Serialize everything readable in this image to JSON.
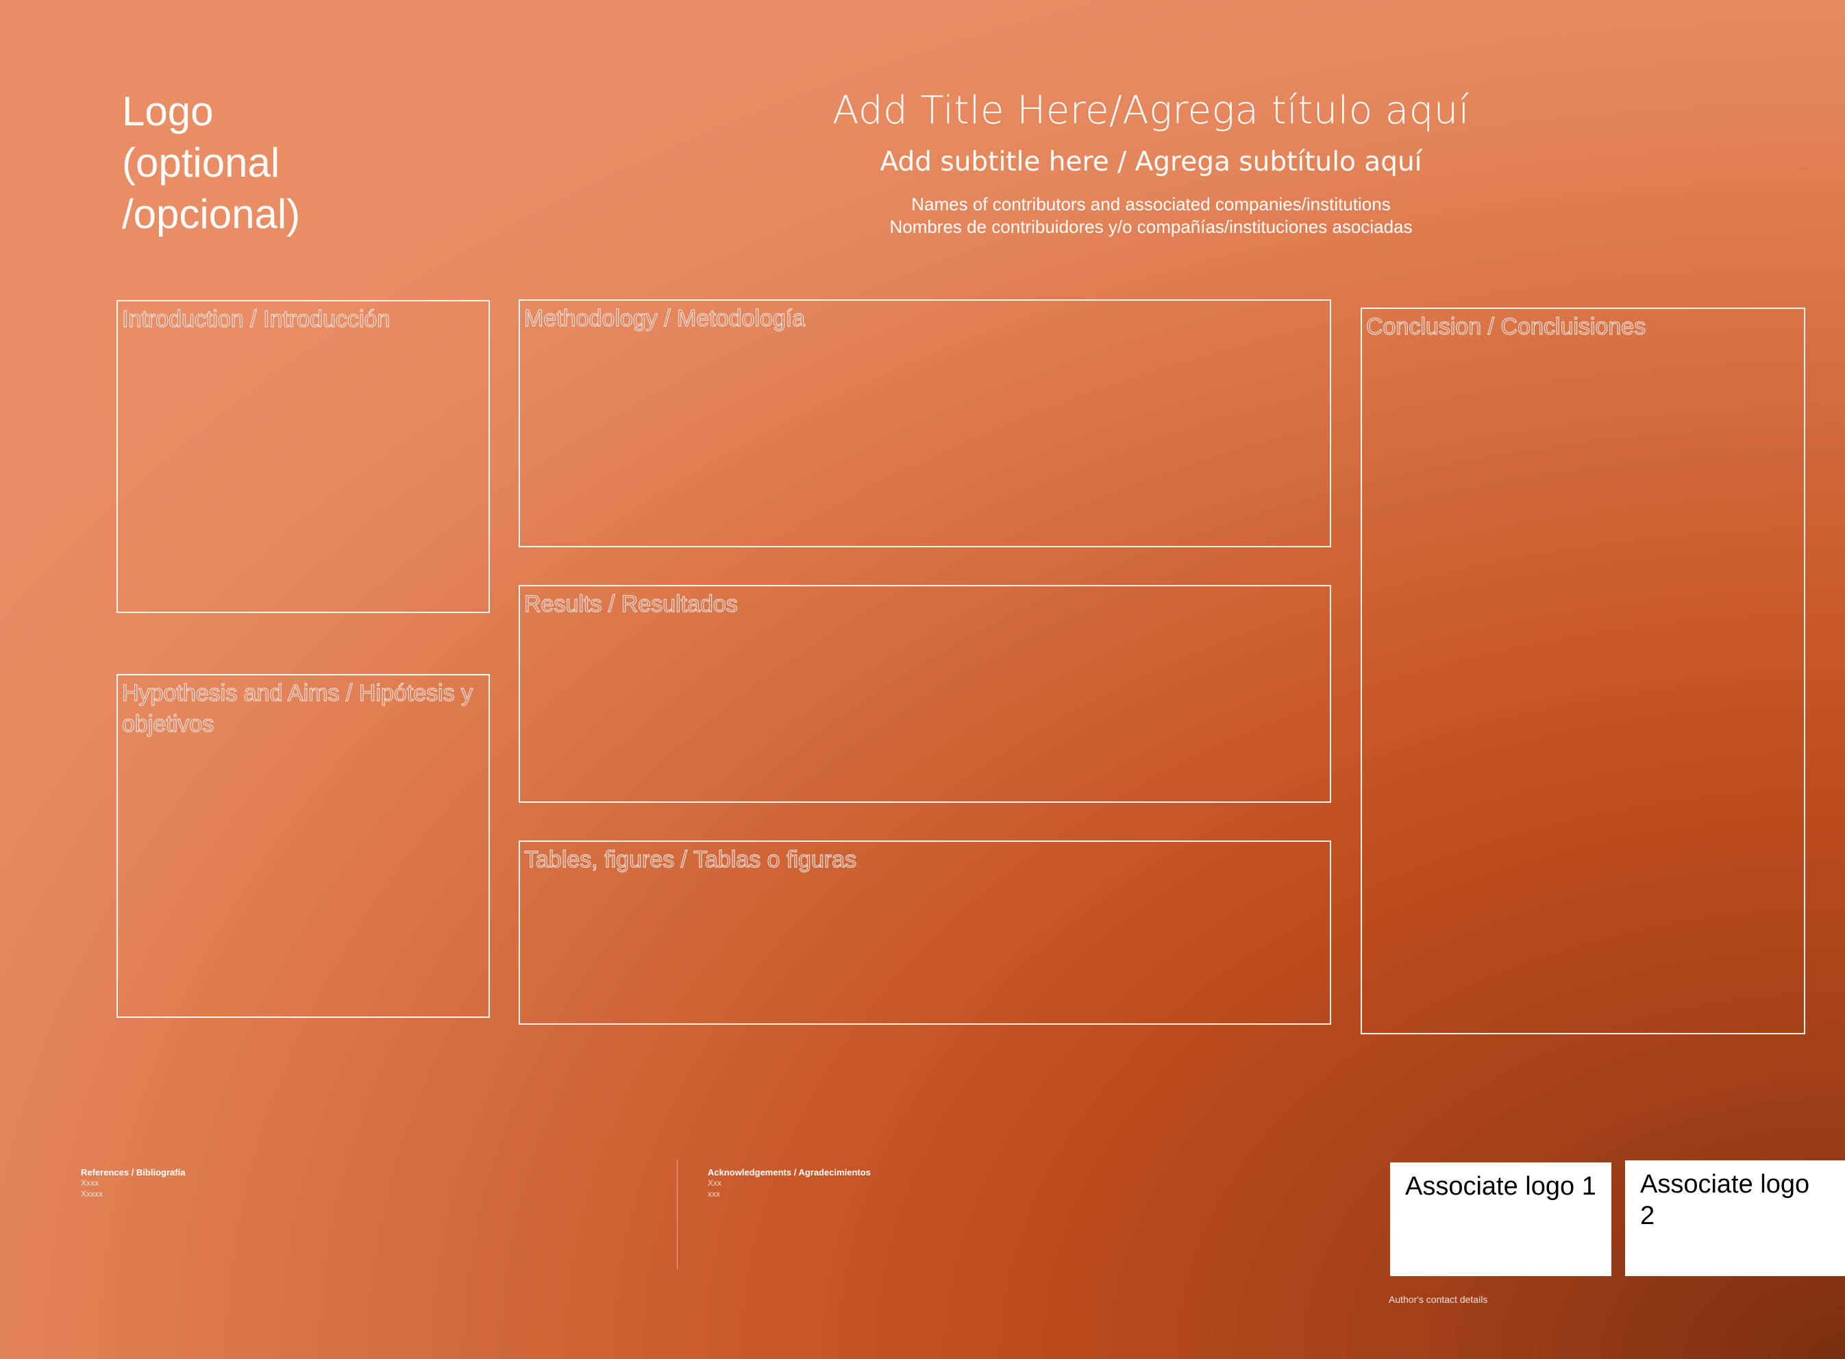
{
  "logo": {
    "line1": "Logo",
    "line2": "(optional",
    "line3": "/opcional)"
  },
  "header": {
    "title": "Add Title Here/Agrega título aquí",
    "subtitle": "Add subtitle here / Agrega subtítulo aquí",
    "contributors_en": "Names of contributors and associated companies/institutions",
    "contributors_es": "Nombres de contribuidores y/o compañías/instituciones asociadas"
  },
  "sections": {
    "introduction": "Introduction / Introducción",
    "hypothesis": "Hypothesis and Aims / Hipótesis y objetivos",
    "methodology": "Methodology / Metodología",
    "results": "Results / Resultados",
    "tables": "Tables, figures / Tablas o figuras",
    "conclusion": "Conclusion / Concluisiones"
  },
  "footer": {
    "references": {
      "label": "References / Bibliografía",
      "lines": [
        "Xxxx",
        "Xxxxx"
      ]
    },
    "acknowledgements": {
      "label": "Acknowledgements / Agradecimientos",
      "lines": [
        "Xxx",
        "xxx"
      ]
    },
    "associate_logo_1": "Associate logo 1",
    "associate_logo_2": "Associate logo 2",
    "contact": "Author's contact details"
  }
}
